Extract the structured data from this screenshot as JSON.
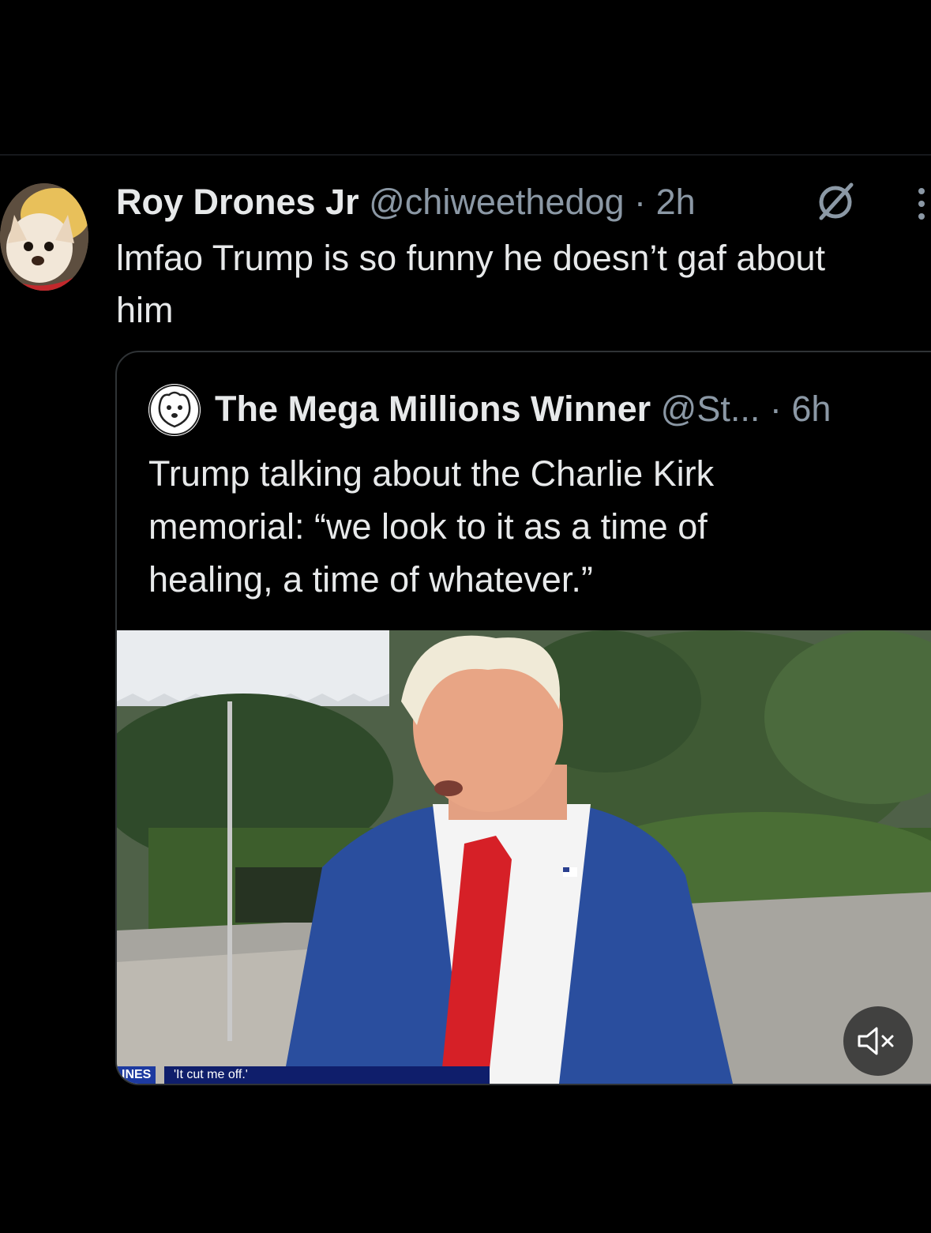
{
  "tweet": {
    "display_name": "Roy Drones Jr",
    "handle": "@chiweethedog",
    "separator": "·",
    "time": "2h",
    "text_lines": [
      "lmfao Trump is so funny he doesn’t gaf about",
      "him"
    ]
  },
  "quote": {
    "display_name": "The Mega Millions Winner",
    "handle": "@St...",
    "separator": "·",
    "time": "6h",
    "text_lines": [
      "Trump talking about the Charlie Kirk",
      "memorial: “we look to it as a time of",
      "healing, a time of whatever.”"
    ]
  },
  "media": {
    "chyron_tag": "INES",
    "chyron_text": "'It cut me off.'",
    "mute_icon": "muted-speaker-icon"
  },
  "icons": {
    "grok": "grok-icon",
    "more": "more-vertical-icon"
  },
  "colors": {
    "background": "#000000",
    "primary_text": "#e7e9ea",
    "secondary_text": "#8b98a5",
    "border": "#2f3336",
    "tie": "#d62027",
    "suit": "#2a4e9e"
  }
}
